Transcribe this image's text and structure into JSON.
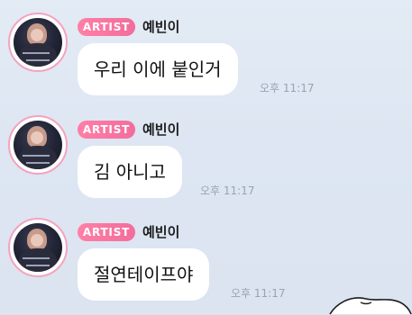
{
  "colors": {
    "background": "#dde6f2",
    "badge": "#f26d9c",
    "bubble": "#ffffff",
    "timestamp": "#9aa3b0"
  },
  "messages": [
    {
      "badge": "ARTIST",
      "sender": "예빈이",
      "text": "우리 이에 붙인거",
      "time": "오후 11:17",
      "avatar_icon": "profile-photo"
    },
    {
      "badge": "ARTIST",
      "sender": "예빈이",
      "text": "김 아니고",
      "time": "오후 11:17",
      "avatar_icon": "profile-photo"
    },
    {
      "badge": "ARTIST",
      "sender": "예빈이",
      "text": "절연테이프야",
      "time": "오후 11:17",
      "avatar_icon": "profile-photo"
    }
  ]
}
